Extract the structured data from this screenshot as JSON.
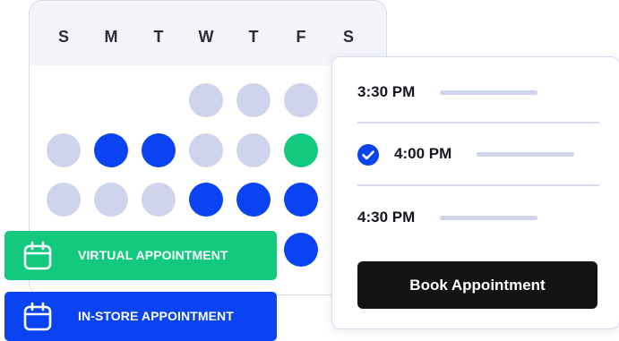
{
  "calendar": {
    "day_labels": [
      "S",
      "M",
      "T",
      "W",
      "T",
      "F",
      "S"
    ],
    "rows": [
      [
        "empty",
        "empty",
        "empty",
        "muted",
        "muted",
        "muted",
        "empty"
      ],
      [
        "muted",
        "active",
        "active",
        "muted",
        "muted",
        "selected",
        "empty"
      ],
      [
        "muted",
        "muted",
        "muted",
        "active",
        "active",
        "active",
        "empty"
      ],
      [
        "empty",
        "empty",
        "empty",
        "empty",
        "empty",
        "active",
        "empty"
      ]
    ]
  },
  "time_slots": [
    {
      "label": "3:30 PM",
      "checked": false
    },
    {
      "label": "4:00 PM",
      "checked": true
    },
    {
      "label": "4:30 PM",
      "checked": false
    }
  ],
  "book_button": {
    "label": "Book Appointment"
  },
  "appointment_types": {
    "virtual": {
      "label": "VIRTUAL APPOINTMENT"
    },
    "instore": {
      "label": "IN-STORE APPOINTMENT"
    }
  },
  "colors": {
    "active": "#0a44f2",
    "selected": "#13c97e",
    "muted": "#cfd3ec",
    "button_dark": "#141414"
  },
  "icons": {
    "appointment_icon": "calendar-icon",
    "check_icon": "check-circle-icon"
  }
}
